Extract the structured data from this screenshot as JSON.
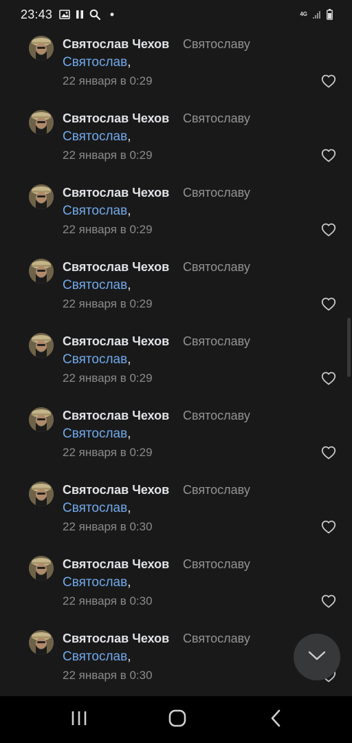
{
  "status_bar": {
    "time": "23:43",
    "network_label": "4G"
  },
  "comments": [
    {
      "author": "Святослав Чехов",
      "reply_to": "Святославу",
      "mention": "Святослав",
      "suffix": ",",
      "date": "22 января в 0:29"
    },
    {
      "author": "Святослав Чехов",
      "reply_to": "Святославу",
      "mention": "Святослав",
      "suffix": ",",
      "date": "22 января в 0:29"
    },
    {
      "author": "Святослав Чехов",
      "reply_to": "Святославу",
      "mention": "Святослав",
      "suffix": ",",
      "date": "22 января в 0:29"
    },
    {
      "author": "Святослав Чехов",
      "reply_to": "Святославу",
      "mention": "Святослав",
      "suffix": ",",
      "date": "22 января в 0:29"
    },
    {
      "author": "Святослав Чехов",
      "reply_to": "Святославу",
      "mention": "Святослав",
      "suffix": ",",
      "date": "22 января в 0:29"
    },
    {
      "author": "Святослав Чехов",
      "reply_to": "Святославу",
      "mention": "Святослав",
      "suffix": ",",
      "date": "22 января в 0:29"
    },
    {
      "author": "Святослав Чехов",
      "reply_to": "Святославу",
      "mention": "Святослав",
      "suffix": ",",
      "date": "22 января в 0:30"
    },
    {
      "author": "Святослав Чехов",
      "reply_to": "Святославу",
      "mention": "Святослав",
      "suffix": ",",
      "date": "22 января в 0:30"
    },
    {
      "author": "Святослав Чехов",
      "reply_to": "Святославу",
      "mention": "Святослав",
      "suffix": ",",
      "date": "22 января в 0:30"
    }
  ],
  "icons": {
    "like": "heart-outline-icon",
    "fab": "chevron-down-icon",
    "nav_recents": "recents-icon",
    "nav_home": "home-icon",
    "nav_back": "back-icon"
  },
  "colors": {
    "background": "#19191a",
    "link": "#71aaeb",
    "secondary_text": "#8b8b8b",
    "fab": "#37383a"
  }
}
